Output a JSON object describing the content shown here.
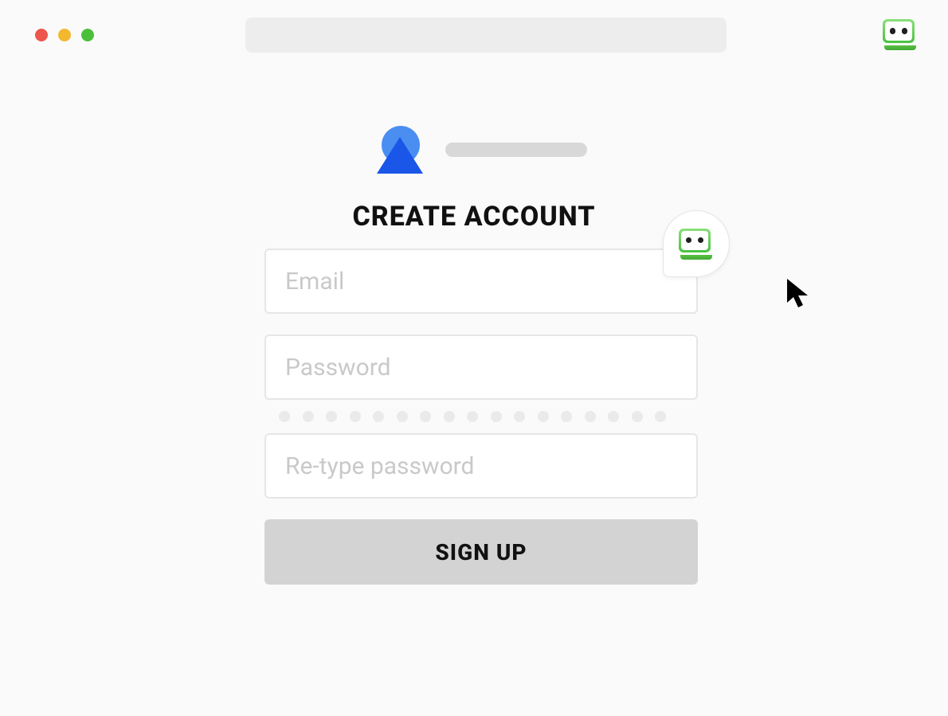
{
  "window": {
    "traffic_lights": [
      "close",
      "minimize",
      "zoom"
    ]
  },
  "address_bar": {
    "value": ""
  },
  "extension_icon": "roboform-icon",
  "page": {
    "logo_icon": "abstract-triangle-circle-logo",
    "logo_text": "",
    "title": "CREATE ACCOUNT"
  },
  "form": {
    "email": {
      "placeholder": "Email",
      "value": ""
    },
    "password": {
      "placeholder": "Password",
      "value": ""
    },
    "retype_password": {
      "placeholder": "Re-type password",
      "value": ""
    },
    "submit_label": "SIGN UP"
  },
  "autofill_badge_icon": "roboform-icon",
  "cursor_icon": "mouse-pointer-icon"
}
